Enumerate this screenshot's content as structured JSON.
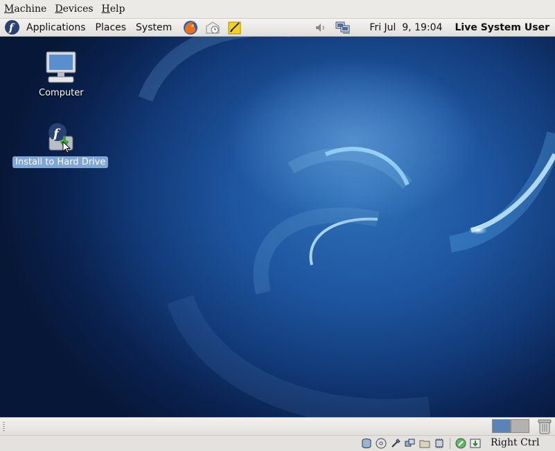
{
  "vbox_menu": [
    {
      "label": "Machine"
    },
    {
      "label": "Devices"
    },
    {
      "label": "Help"
    }
  ],
  "top_panel": {
    "menus": [
      "Applications",
      "Places",
      "System"
    ],
    "launchers": [
      "firefox-icon",
      "evolution-mail-icon",
      "notes-icon"
    ],
    "tray": [
      "volume-icon",
      "network-icon"
    ],
    "clock": "Fri Jul  9, 19:04",
    "user": "Live System User"
  },
  "desktop": {
    "icons": [
      {
        "label": "Computer",
        "icon": "computer-icon",
        "selected": false
      },
      {
        "label": "Install to Hard Drive",
        "icon": "install-icon",
        "selected": true
      }
    ]
  },
  "bottom_panel": {
    "workspaces": 2,
    "active_workspace": 1
  },
  "statusbar": {
    "host_key": "Right Ctrl"
  },
  "colors": {
    "desktop_blue": "#1e56a0",
    "selection": "#7fa6d4",
    "fedora_blue": "#294172"
  }
}
